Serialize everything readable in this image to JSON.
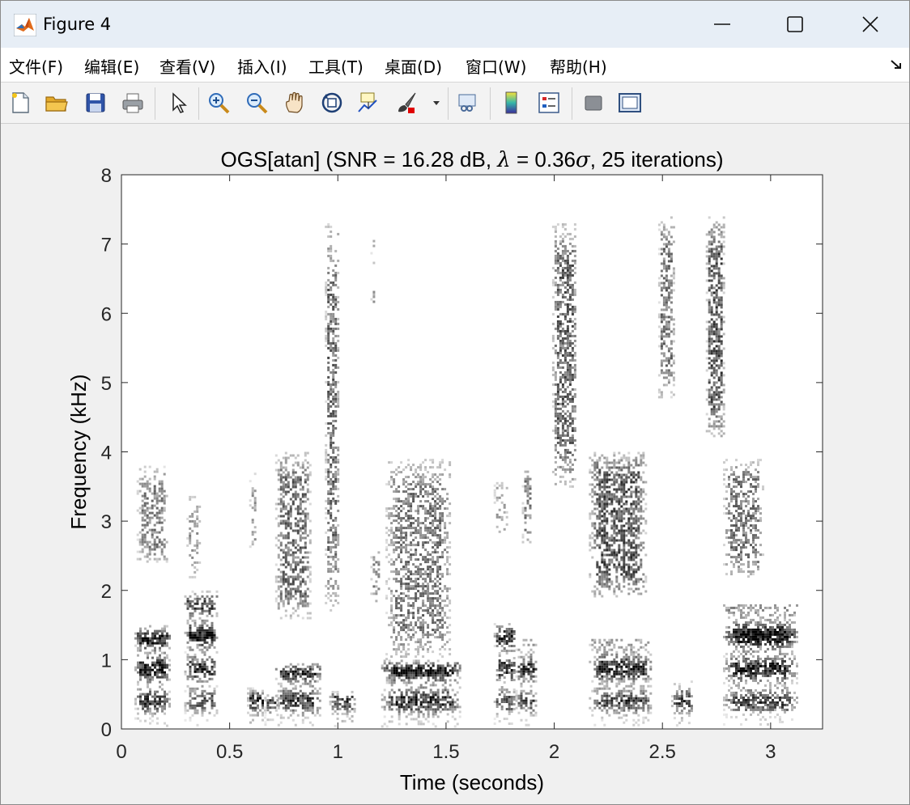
{
  "window": {
    "title": "Figure 4",
    "controls": {
      "minimize": "minimize",
      "maximize": "maximize",
      "close": "close"
    }
  },
  "menubar": {
    "items": [
      "文件(F)",
      "编辑(E)",
      "查看(V)",
      "插入(I)",
      "工具(T)",
      "桌面(D)",
      "窗口(W)",
      "帮助(H)"
    ]
  },
  "toolbar": {
    "buttons": [
      {
        "icon": "new-file-icon"
      },
      {
        "icon": "open-folder-icon"
      },
      {
        "icon": "save-icon"
      },
      {
        "icon": "print-icon"
      },
      {
        "icon": "pointer-icon"
      },
      {
        "icon": "zoom-in-icon"
      },
      {
        "icon": "zoom-out-icon"
      },
      {
        "icon": "pan-hand-icon"
      },
      {
        "icon": "rotate-3d-icon"
      },
      {
        "icon": "data-cursor-icon"
      },
      {
        "icon": "brush-icon"
      },
      {
        "icon": "link-plot-icon"
      },
      {
        "icon": "colorbar-icon"
      },
      {
        "icon": "legend-icon"
      },
      {
        "icon": "hide-plot-tools-icon"
      },
      {
        "icon": "show-plot-tools-icon"
      }
    ]
  },
  "chart_data": {
    "type": "heatmap",
    "title_parts": [
      "OGS[atan] (SNR = 16.28 dB, ",
      "λ",
      " = 0.36",
      "σ",
      ", 25 iterations)"
    ],
    "xlabel": "Time (seconds)",
    "ylabel": "Frequency (kHz)",
    "xlim": [
      0,
      3.24
    ],
    "ylim": [
      0,
      8
    ],
    "xticks": [
      0,
      0.5,
      1,
      1.5,
      2,
      2.5,
      3
    ],
    "xtick_labels": [
      "0",
      "0.5",
      "1",
      "1.5",
      "2",
      "2.5",
      "3"
    ],
    "yticks": [
      0,
      1,
      2,
      3,
      4,
      5,
      6,
      7,
      8
    ],
    "ytick_labels": [
      "0",
      "1",
      "2",
      "3",
      "4",
      "5",
      "6",
      "7",
      "8"
    ],
    "colormap": [
      "#ffffff",
      "#000000"
    ],
    "grid": false,
    "regions": [
      {
        "t0": 0.06,
        "t1": 0.22,
        "f0": 0.05,
        "f1": 1.5,
        "intensity": 0.9,
        "harmonic": true
      },
      {
        "t0": 0.07,
        "t1": 0.21,
        "f0": 2.4,
        "f1": 3.8,
        "intensity": 0.55,
        "harmonic": false
      },
      {
        "t0": 0.29,
        "t1": 0.44,
        "f0": 0.05,
        "f1": 2.0,
        "intensity": 0.85,
        "harmonic": true
      },
      {
        "t0": 0.3,
        "t1": 0.36,
        "f0": 2.2,
        "f1": 3.4,
        "intensity": 0.45,
        "harmonic": false
      },
      {
        "t0": 0.58,
        "t1": 0.66,
        "f0": 0.05,
        "f1": 0.6,
        "intensity": 0.75,
        "harmonic": true
      },
      {
        "t0": 0.59,
        "t1": 0.62,
        "f0": 2.6,
        "f1": 3.7,
        "intensity": 0.45,
        "harmonic": false
      },
      {
        "t0": 0.66,
        "t1": 0.72,
        "f0": 0.05,
        "f1": 0.5,
        "intensity": 0.6,
        "harmonic": true
      },
      {
        "t0": 0.71,
        "t1": 0.92,
        "f0": 0.05,
        "f1": 0.95,
        "intensity": 0.85,
        "harmonic": true
      },
      {
        "t0": 0.71,
        "t1": 0.87,
        "f0": 1.6,
        "f1": 4.0,
        "intensity": 0.65,
        "harmonic": false
      },
      {
        "t0": 0.94,
        "t1": 1.0,
        "f0": 1.7,
        "f1": 7.3,
        "intensity": 0.65,
        "harmonic": false
      },
      {
        "t0": 0.96,
        "t1": 1.08,
        "f0": 0.05,
        "f1": 0.55,
        "intensity": 0.7,
        "harmonic": true
      },
      {
        "t0": 1.15,
        "t1": 1.19,
        "f0": 1.8,
        "f1": 2.6,
        "intensity": 0.5,
        "harmonic": false
      },
      {
        "t0": 1.15,
        "t1": 1.17,
        "f0": 5.9,
        "f1": 7.2,
        "intensity": 0.4,
        "harmonic": false
      },
      {
        "t0": 1.2,
        "t1": 1.57,
        "f0": 0.05,
        "f1": 1.0,
        "intensity": 0.9,
        "harmonic": true
      },
      {
        "t0": 1.22,
        "t1": 1.52,
        "f0": 1.0,
        "f1": 3.9,
        "intensity": 0.6,
        "harmonic": false
      },
      {
        "t0": 1.72,
        "t1": 1.82,
        "f0": 0.05,
        "f1": 1.6,
        "intensity": 0.8,
        "harmonic": true
      },
      {
        "t0": 1.72,
        "t1": 1.78,
        "f0": 2.8,
        "f1": 3.6,
        "intensity": 0.4,
        "harmonic": false
      },
      {
        "t0": 1.82,
        "t1": 1.92,
        "f0": 0.05,
        "f1": 1.3,
        "intensity": 0.75,
        "harmonic": true
      },
      {
        "t0": 1.85,
        "t1": 1.89,
        "f0": 2.7,
        "f1": 3.8,
        "intensity": 0.55,
        "harmonic": false
      },
      {
        "t0": 1.99,
        "t1": 2.1,
        "f0": 3.5,
        "f1": 7.3,
        "intensity": 0.7,
        "harmonic": false
      },
      {
        "t0": 2.16,
        "t1": 2.45,
        "f0": 0.05,
        "f1": 1.3,
        "intensity": 0.85,
        "harmonic": true
      },
      {
        "t0": 2.16,
        "t1": 2.42,
        "f0": 1.9,
        "f1": 4.0,
        "intensity": 0.75,
        "harmonic": false
      },
      {
        "t0": 2.48,
        "t1": 2.55,
        "f0": 4.8,
        "f1": 7.4,
        "intensity": 0.6,
        "harmonic": false
      },
      {
        "t0": 2.54,
        "t1": 2.64,
        "f0": 0.05,
        "f1": 0.7,
        "intensity": 0.7,
        "harmonic": true
      },
      {
        "t0": 2.7,
        "t1": 2.78,
        "f0": 4.2,
        "f1": 7.4,
        "intensity": 0.75,
        "harmonic": false
      },
      {
        "t0": 2.78,
        "t1": 3.12,
        "f0": 0.05,
        "f1": 1.8,
        "intensity": 0.9,
        "harmonic": true
      },
      {
        "t0": 2.78,
        "t1": 2.96,
        "f0": 2.2,
        "f1": 3.9,
        "intensity": 0.6,
        "harmonic": false
      }
    ]
  }
}
